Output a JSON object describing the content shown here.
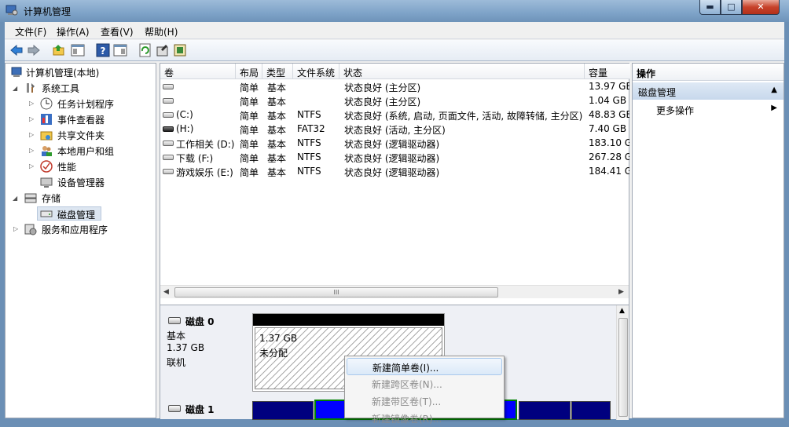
{
  "window": {
    "title": "计算机管理",
    "buttons": {
      "minimize": "▬",
      "maximize": "□",
      "close": "✕"
    }
  },
  "menu": [
    "文件(F)",
    "操作(A)",
    "查看(V)",
    "帮助(H)"
  ],
  "toolbar_icons": [
    "back-icon",
    "forward-icon",
    "up-icon",
    "show-tree-icon",
    "help-icon",
    "properties-icon",
    "refresh-icon",
    "export-icon",
    "snapin-icon"
  ],
  "tree": {
    "root": "计算机管理(本地)",
    "system_tools": "系统工具",
    "task_scheduler": "任务计划程序",
    "event_viewer": "事件查看器",
    "shared_folders": "共享文件夹",
    "local_users": "本地用户和组",
    "performance": "性能",
    "device_manager": "设备管理器",
    "storage": "存储",
    "disk_management": "磁盘管理",
    "services_apps": "服务和应用程序"
  },
  "volumes": {
    "headers": [
      "卷",
      "布局",
      "类型",
      "文件系统",
      "状态",
      "容量"
    ],
    "rows": [
      [
        "",
        "简单",
        "基本",
        "",
        "状态良好 (主分区)",
        "13.97 GB"
      ],
      [
        "",
        "简单",
        "基本",
        "",
        "状态良好 (主分区)",
        "1.04 GB"
      ],
      [
        "(C:)",
        "简单",
        "基本",
        "NTFS",
        "状态良好 (系统, 启动, 页面文件, 活动, 故障转储, 主分区)",
        "48.83 GB"
      ],
      [
        "(H:)",
        "简单",
        "基本",
        "FAT32",
        "状态良好 (活动, 主分区)",
        "7.40 GB"
      ],
      [
        "工作相关 (D:)",
        "简单",
        "基本",
        "NTFS",
        "状态良好 (逻辑驱动器)",
        "183.10 G"
      ],
      [
        "下载 (F:)",
        "简单",
        "基本",
        "NTFS",
        "状态良好 (逻辑驱动器)",
        "267.28 G"
      ],
      [
        "游戏娱乐 (E:)",
        "简单",
        "基本",
        "NTFS",
        "状态良好 (逻辑驱动器)",
        "184.41 G"
      ]
    ],
    "scroll_grip": "III"
  },
  "disks": [
    {
      "name": "磁盘 0",
      "type": "基本",
      "size": "1.37 GB",
      "status": "联机",
      "partition_size": "1.37 GB",
      "partition_label": "未分配"
    },
    {
      "name": "磁盘 1"
    }
  ],
  "context_menu": [
    {
      "label": "新建简单卷(I)...",
      "enabled": true
    },
    {
      "label": "新建跨区卷(N)...",
      "enabled": false
    },
    {
      "label": "新建带区卷(T)...",
      "enabled": false
    },
    {
      "label": "新建镜像卷(R)...",
      "enabled": false
    }
  ],
  "actions": {
    "header": "操作",
    "section": "磁盘管理",
    "more": "更多操作"
  },
  "colors": {
    "primary_partition": "#00007f",
    "selected_partition": "#0000ff",
    "unallocated_bar": "#000000",
    "selection_border": "#008000"
  }
}
